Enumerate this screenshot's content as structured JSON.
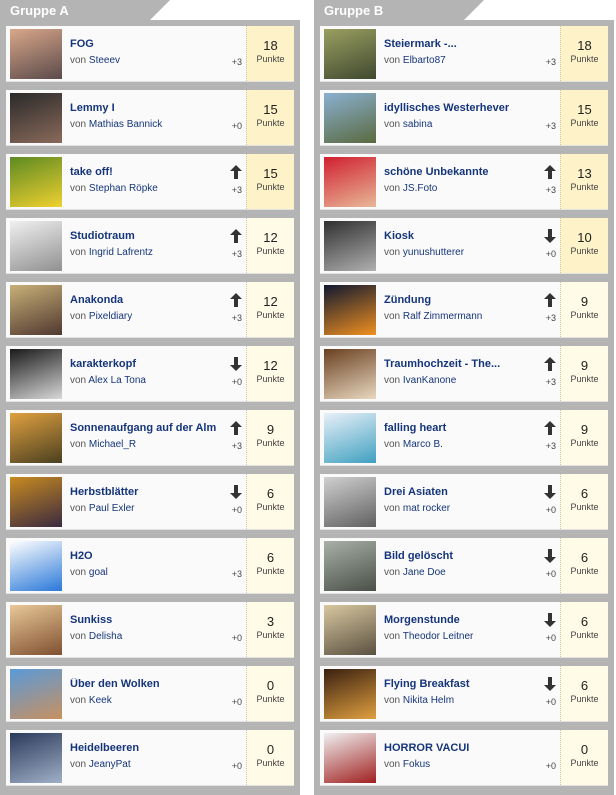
{
  "groups": [
    {
      "name": "Gruppe A",
      "entries": [
        {
          "title": "FOG",
          "by": "von",
          "author": "Steeev",
          "trend": "none",
          "delta": "+3",
          "points": "18",
          "unit": "Punkte",
          "tier": "gold",
          "colors": [
            "#d9a78a",
            "#5a4a4a"
          ]
        },
        {
          "title": "Lemmy I",
          "by": "von",
          "author": "Mathias Bannick",
          "trend": "none",
          "delta": "+0",
          "points": "15",
          "unit": "Punkte",
          "tier": "gold",
          "colors": [
            "#2a2a2a",
            "#8a6a5a"
          ]
        },
        {
          "title": "take off!",
          "by": "von",
          "author": "Stephan Röpke",
          "trend": "up",
          "delta": "+3",
          "points": "15",
          "unit": "Punkte",
          "tier": "gold",
          "colors": [
            "#5d8a22",
            "#f0d030"
          ]
        },
        {
          "title": "Studiotraum",
          "by": "von",
          "author": "Ingrid Lafrentz",
          "trend": "up",
          "delta": "+3",
          "points": "12",
          "unit": "Punkte",
          "tier": "cream",
          "colors": [
            "#f0f0f0",
            "#909090"
          ]
        },
        {
          "title": "Anakonda",
          "by": "von",
          "author": "Pixeldiary",
          "trend": "up",
          "delta": "+3",
          "points": "12",
          "unit": "Punkte",
          "tier": "cream",
          "colors": [
            "#c8b078",
            "#503830"
          ]
        },
        {
          "title": "karakterkopf",
          "by": "von",
          "author": "Alex La Tona",
          "trend": "down",
          "delta": "+0",
          "points": "12",
          "unit": "Punkte",
          "tier": "cream",
          "colors": [
            "#1a1a1a",
            "#d8d8d8"
          ]
        },
        {
          "title": "Sonnenaufgang auf der Alm",
          "by": "von",
          "author": "Michael_R",
          "trend": "up",
          "delta": "+3",
          "points": "9",
          "unit": "Punkte",
          "tier": "cream",
          "colors": [
            "#e0a040",
            "#4a4020"
          ]
        },
        {
          "title": "Herbstblätter",
          "by": "von",
          "author": "Paul Exler",
          "trend": "down",
          "delta": "+0",
          "points": "6",
          "unit": "Punkte",
          "tier": "cream",
          "colors": [
            "#c88a20",
            "#3a2a40"
          ]
        },
        {
          "title": "H2O",
          "by": "von",
          "author": "goal",
          "trend": "none",
          "delta": "+3",
          "points": "6",
          "unit": "Punkte",
          "tier": "cream",
          "colors": [
            "#ffffff",
            "#2a78d8"
          ]
        },
        {
          "title": "Sunkiss",
          "by": "von",
          "author": "Delisha",
          "trend": "none",
          "delta": "+0",
          "points": "3",
          "unit": "Punkte",
          "tier": "cream",
          "colors": [
            "#e8c898",
            "#805030"
          ]
        },
        {
          "title": "Über den Wolken",
          "by": "von",
          "author": "Keek",
          "trend": "none",
          "delta": "+0",
          "points": "0",
          "unit": "Punkte",
          "tier": "cream",
          "colors": [
            "#5a9ad8",
            "#c89060"
          ]
        },
        {
          "title": "Heidelbeeren",
          "by": "von",
          "author": "JeanyPat",
          "trend": "none",
          "delta": "+0",
          "points": "0",
          "unit": "Punkte",
          "tier": "cream",
          "colors": [
            "#2a3a5a",
            "#a0b0c8"
          ]
        }
      ]
    },
    {
      "name": "Gruppe B",
      "entries": [
        {
          "title": "Steiermark -...",
          "by": "von",
          "author": "Elbarto87",
          "trend": "none",
          "delta": "+3",
          "points": "18",
          "unit": "Punkte",
          "tier": "gold",
          "colors": [
            "#9aa060",
            "#404830"
          ]
        },
        {
          "title": "idyllisches Westerhever",
          "by": "von",
          "author": "sabina",
          "trend": "none",
          "delta": "+3",
          "points": "15",
          "unit": "Punkte",
          "tier": "gold",
          "colors": [
            "#8ab0d0",
            "#5a6a40"
          ]
        },
        {
          "title": "schöne Unbekannte",
          "by": "von",
          "author": "JS.Foto",
          "trend": "up",
          "delta": "+3",
          "points": "13",
          "unit": "Punkte",
          "tier": "gold",
          "colors": [
            "#d02030",
            "#e8b898"
          ]
        },
        {
          "title": "Kiosk",
          "by": "von",
          "author": "yunushutterer",
          "trend": "down",
          "delta": "+0",
          "points": "10",
          "unit": "Punkte",
          "tier": "gold",
          "colors": [
            "#303030",
            "#b0b0b0"
          ]
        },
        {
          "title": "Zündung",
          "by": "von",
          "author": "Ralf Zimmermann",
          "trend": "up",
          "delta": "+3",
          "points": "9",
          "unit": "Punkte",
          "tier": "cream",
          "colors": [
            "#101830",
            "#f09020"
          ]
        },
        {
          "title": "Traumhochzeit - The...",
          "by": "von",
          "author": "IvanKanone",
          "trend": "up",
          "delta": "+3",
          "points": "9",
          "unit": "Punkte",
          "tier": "cream",
          "colors": [
            "#6a4020",
            "#e8d8c0"
          ]
        },
        {
          "title": "falling heart",
          "by": "von",
          "author": "Marco B.",
          "trend": "up",
          "delta": "+3",
          "points": "9",
          "unit": "Punkte",
          "tier": "cream",
          "colors": [
            "#e8f0f8",
            "#40a0c0"
          ]
        },
        {
          "title": "Drei Asiaten",
          "by": "von",
          "author": "mat rocker",
          "trend": "down",
          "delta": "+0",
          "points": "6",
          "unit": "Punkte",
          "tier": "cream",
          "colors": [
            "#d0d0d0",
            "#606060"
          ]
        },
        {
          "title": "Bild gelöscht",
          "by": "von",
          "author": "Jane Doe",
          "trend": "down",
          "delta": "+0",
          "points": "6",
          "unit": "Punkte",
          "tier": "cream",
          "colors": [
            "#a8b0a8",
            "#4a5048"
          ]
        },
        {
          "title": "Morgenstunde",
          "by": "von",
          "author": "Theodor Leitner",
          "trend": "down",
          "delta": "+0",
          "points": "6",
          "unit": "Punkte",
          "tier": "cream",
          "colors": [
            "#d8c8a0",
            "#5a5040"
          ]
        },
        {
          "title": "Flying Breakfast",
          "by": "von",
          "author": "Nikita Helm",
          "trend": "down",
          "delta": "+0",
          "points": "6",
          "unit": "Punkte",
          "tier": "cream",
          "colors": [
            "#3a2010",
            "#e0a040"
          ]
        },
        {
          "title": "HORROR VACUI",
          "by": "von",
          "author": "Fokus",
          "trend": "none",
          "delta": "+0",
          "points": "0",
          "unit": "Punkte",
          "tier": "cream",
          "colors": [
            "#f0f0f0",
            "#a02020"
          ]
        }
      ]
    }
  ]
}
